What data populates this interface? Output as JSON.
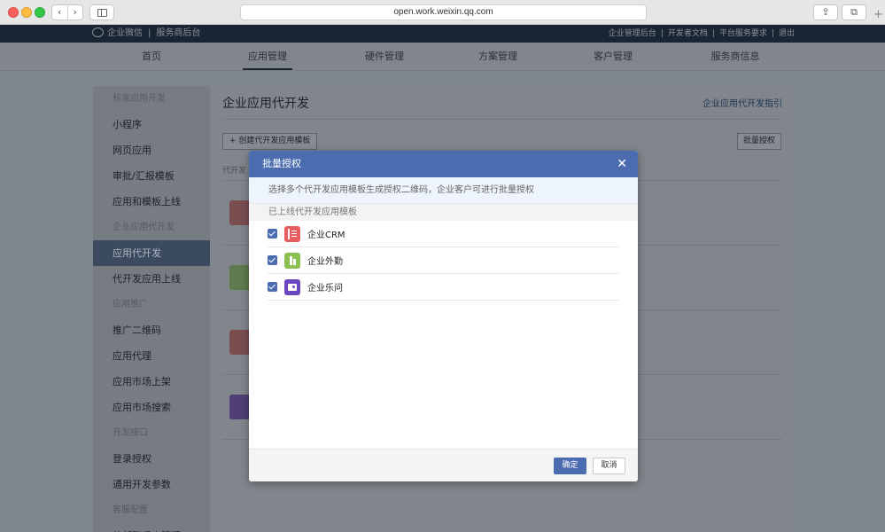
{
  "browser": {
    "url": "open.work.weixin.qq.com",
    "back": "‹",
    "forward": "›",
    "share": "⇪",
    "tabs": "⧉",
    "new_tab": "+"
  },
  "header": {
    "brand": "企业微信",
    "brand_separator": "|",
    "subtitle": "服务商后台",
    "links": [
      "企业管理后台",
      "开发者文档",
      "平台服务要求",
      "退出"
    ],
    "link_separator": "|"
  },
  "nav": {
    "items": [
      "首页",
      "应用管理",
      "硬件管理",
      "方案管理",
      "客户管理",
      "服务商信息"
    ],
    "active": "应用管理"
  },
  "sidebar": {
    "items": [
      {
        "label": "标准应用开发",
        "group": true
      },
      {
        "label": "小程序"
      },
      {
        "label": "网页应用"
      },
      {
        "label": "审批/汇报模板"
      },
      {
        "label": "应用和模板上线"
      },
      {
        "label": "企业应用代开发",
        "group": true
      },
      {
        "label": "应用代开发",
        "active": true
      },
      {
        "label": "代开发应用上线"
      },
      {
        "label": "应用推广",
        "group": true
      },
      {
        "label": "推广二维码"
      },
      {
        "label": "应用代理"
      },
      {
        "label": "应用市场上架"
      },
      {
        "label": "应用市场搜索"
      },
      {
        "label": "开发接口",
        "group": true
      },
      {
        "label": "登录授权"
      },
      {
        "label": "通用开发参数"
      },
      {
        "label": "客服配置",
        "group": true
      },
      {
        "label": "外部联系人管理"
      }
    ]
  },
  "main": {
    "title": "企业应用代开发",
    "guide_link": "企业应用代开发指引",
    "create_button": "+ 创建代开发应用模板",
    "batch_button": "批量授权",
    "column_header": "代开发"
  },
  "modal": {
    "title": "批量授权",
    "close": "✕",
    "description": "选择多个代开发应用模板生成授权二维码，企业客户可进行批量授权",
    "section_label": "已上线代开发应用模板",
    "apps": [
      {
        "name": "企业CRM",
        "icon": "crm-icon",
        "checked": true,
        "color": "#e85d5d"
      },
      {
        "name": "企业外勤",
        "icon": "field-work-icon",
        "checked": true,
        "color": "#8cc152"
      },
      {
        "name": "企业乐问",
        "icon": "lewen-icon",
        "checked": true,
        "color": "#6b46c1"
      }
    ],
    "confirm": "确定",
    "cancel": "取消"
  },
  "colors": {
    "accent": "#4b6db0",
    "header_dark": "#1a2533",
    "sidebar_active": "#3b4a5e"
  }
}
